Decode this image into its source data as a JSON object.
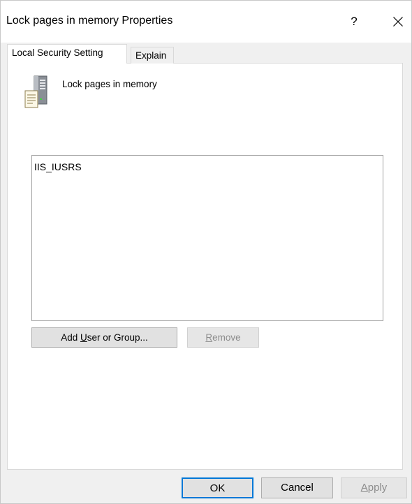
{
  "window": {
    "title": "Lock pages in memory Properties",
    "help_label": "?"
  },
  "tabs": [
    {
      "label": "Local Security Setting",
      "active": true
    },
    {
      "label": "Explain",
      "active": false
    }
  ],
  "policy": {
    "icon": "server-policy-icon",
    "name": "Lock pages in memory"
  },
  "accounts": {
    "items": [
      "IIS_IUSRS"
    ]
  },
  "actions": {
    "add": {
      "pre": "Add ",
      "key": "U",
      "post": "ser or Group..."
    },
    "remove": {
      "pre": "",
      "key": "R",
      "post": "emove",
      "enabled": false
    }
  },
  "footer": {
    "ok": "OK",
    "cancel": "Cancel",
    "apply": {
      "pre": "",
      "key": "A",
      "post": "pply",
      "enabled": false
    }
  },
  "colors": {
    "accent": "#0078d7",
    "dialog_bg": "#f0f0f0",
    "panel_bg": "#ffffff",
    "disabled_text": "#8d8d8d"
  }
}
